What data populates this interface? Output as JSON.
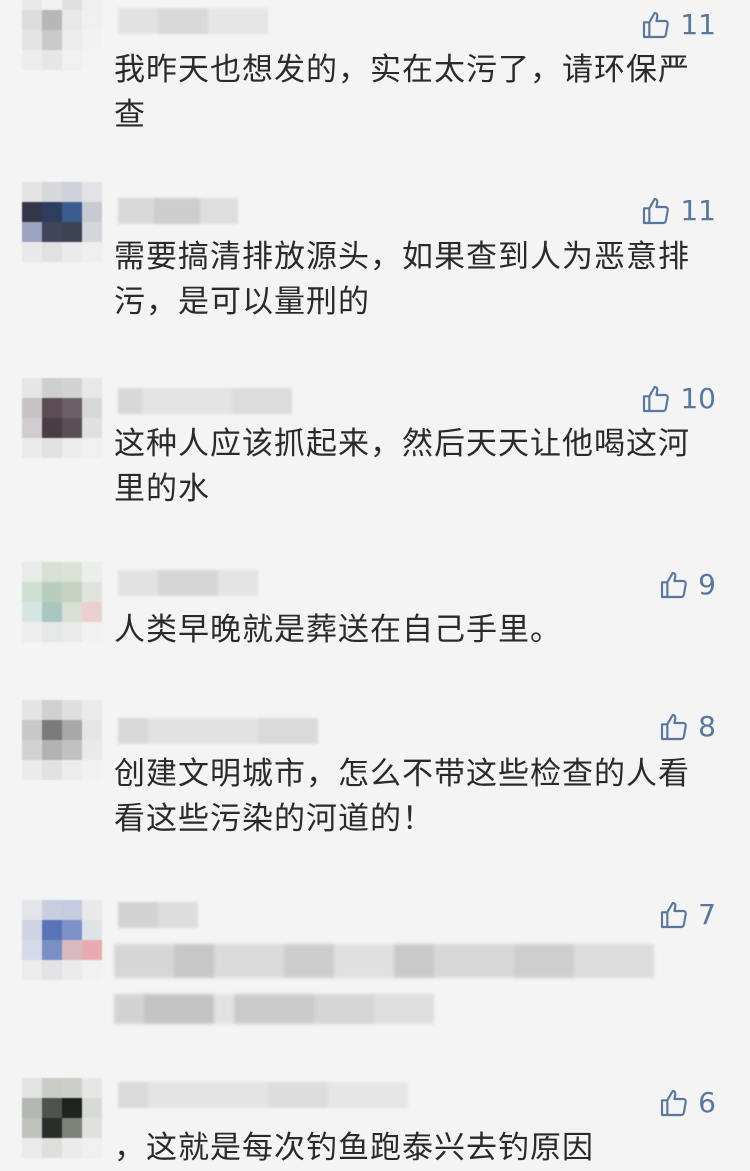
{
  "comments": [
    {
      "likes": "11",
      "text": "我昨天也想发的，实在太污了，请环保严查"
    },
    {
      "likes": "11",
      "text": "需要搞清排放源头，如果查到人为恶意排污，是可以量刑的"
    },
    {
      "likes": "10",
      "text": "这种人应该抓起来，然后天天让他喝这河里的水"
    },
    {
      "likes": "9",
      "text": "人类早晚就是葬送在自己手里。"
    },
    {
      "likes": "8",
      "text": "创建文明城市，怎么不带这些检查的人看看这些污染的河道的！"
    },
    {
      "likes": "7",
      "text": ""
    },
    {
      "likes": "6",
      "text": "，这就是每次钓鱼跑泰兴去钓原因"
    }
  ],
  "icons": {
    "like": "thumbs-up-icon"
  },
  "colors": {
    "like": "#59779d",
    "text": "#2a2a2a",
    "background": "#f4f4f4"
  }
}
